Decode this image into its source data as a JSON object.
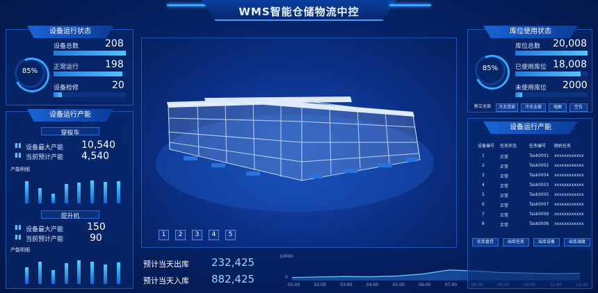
{
  "header": {
    "title": "WMS智能仓储物流中控"
  },
  "left_status": {
    "title": "设备运行状态",
    "ring_percent": "85%",
    "ring_value": 0.85,
    "rows": [
      {
        "label": "设备总数",
        "value": "208",
        "fill": 1.0
      },
      {
        "label": "正常运行",
        "value": "198",
        "fill": 0.95
      },
      {
        "label": "设备检修",
        "value": "20",
        "fill": 0.12
      }
    ]
  },
  "left_capacity": {
    "title": "设备运行产能",
    "section1": {
      "title": "穿梭车",
      "rows": [
        {
          "label": "设备最大产能",
          "value": "10,540"
        },
        {
          "label": "当前预计产能",
          "value": "4,540"
        }
      ],
      "chart_label": "产能明细",
      "values": [
        80,
        55,
        35,
        70,
        75,
        82,
        78,
        80
      ]
    },
    "section2": {
      "title": "提升机",
      "rows": [
        {
          "label": "设备最大产能",
          "value": "150"
        },
        {
          "label": "当前预计产能",
          "value": "90"
        }
      ],
      "chart_label": "产能明细",
      "values": [
        60,
        80,
        50,
        75,
        85,
        80,
        70,
        78
      ]
    }
  },
  "center": {
    "page_buttons": [
      "1",
      "2",
      "3",
      "4",
      "5"
    ]
  },
  "bottom": {
    "out_label": "预计当天出库",
    "out_value": "232,425",
    "in_label": "预计当天入库",
    "in_value": "882,425",
    "y_top": "10000",
    "y_zero": "0",
    "x_ticks": [
      "01:00",
      "02:00",
      "03:00",
      "04:00",
      "05:00",
      "06:00",
      "07:00",
      "08:00",
      "09:00",
      "10:00",
      "11:00",
      "12:00"
    ],
    "values": [
      1200,
      1400,
      1600,
      1500,
      1800,
      2600,
      4200,
      3800,
      3200,
      3000,
      2700,
      2900
    ]
  },
  "right_storage": {
    "title": "库位使用状态",
    "ring_percent": "85%",
    "ring_value": 0.85,
    "rows": [
      {
        "label": "库位总数",
        "value": "20,008",
        "fill": 1.0
      },
      {
        "label": "已使用库位",
        "value": "18,008",
        "fill": 0.9
      },
      {
        "label": "未使用库位",
        "value": "2000",
        "fill": 0.1
      }
    ],
    "filters": [
      "新立全部",
      "冷冻货架",
      "冷冻全部",
      "电解",
      "空位"
    ]
  },
  "right_capacity": {
    "title": "设备运行产能",
    "headers": [
      "设备编号",
      "任务状态",
      "任务编号",
      "随机任务"
    ],
    "rows": [
      [
        "1",
        "正常",
        "Task0001",
        "xxxxxxxxxxxx"
      ],
      [
        "2",
        "正常",
        "Task0002",
        "xxxxxxxxxxxx"
      ],
      [
        "3",
        "正常",
        "Task0004",
        "xxxxxxxxxxxx"
      ],
      [
        "4",
        "正常",
        "Task0003",
        "xxxxxxxxxxxx"
      ],
      [
        "5",
        "正常",
        "Task0005",
        "xxxxxxxxxxxx"
      ],
      [
        "6",
        "正常",
        "Task0007",
        "xxxxxxxxxxxx"
      ],
      [
        "7",
        "正常",
        "Task0009",
        "xxxxxxxxxxxx"
      ],
      [
        "8",
        "正常",
        "Task0008",
        "xxxxxxxxxxxx"
      ]
    ],
    "buttons": [
      "在库盘货",
      "出库任务",
      "出库设备",
      "出库调度"
    ]
  }
}
